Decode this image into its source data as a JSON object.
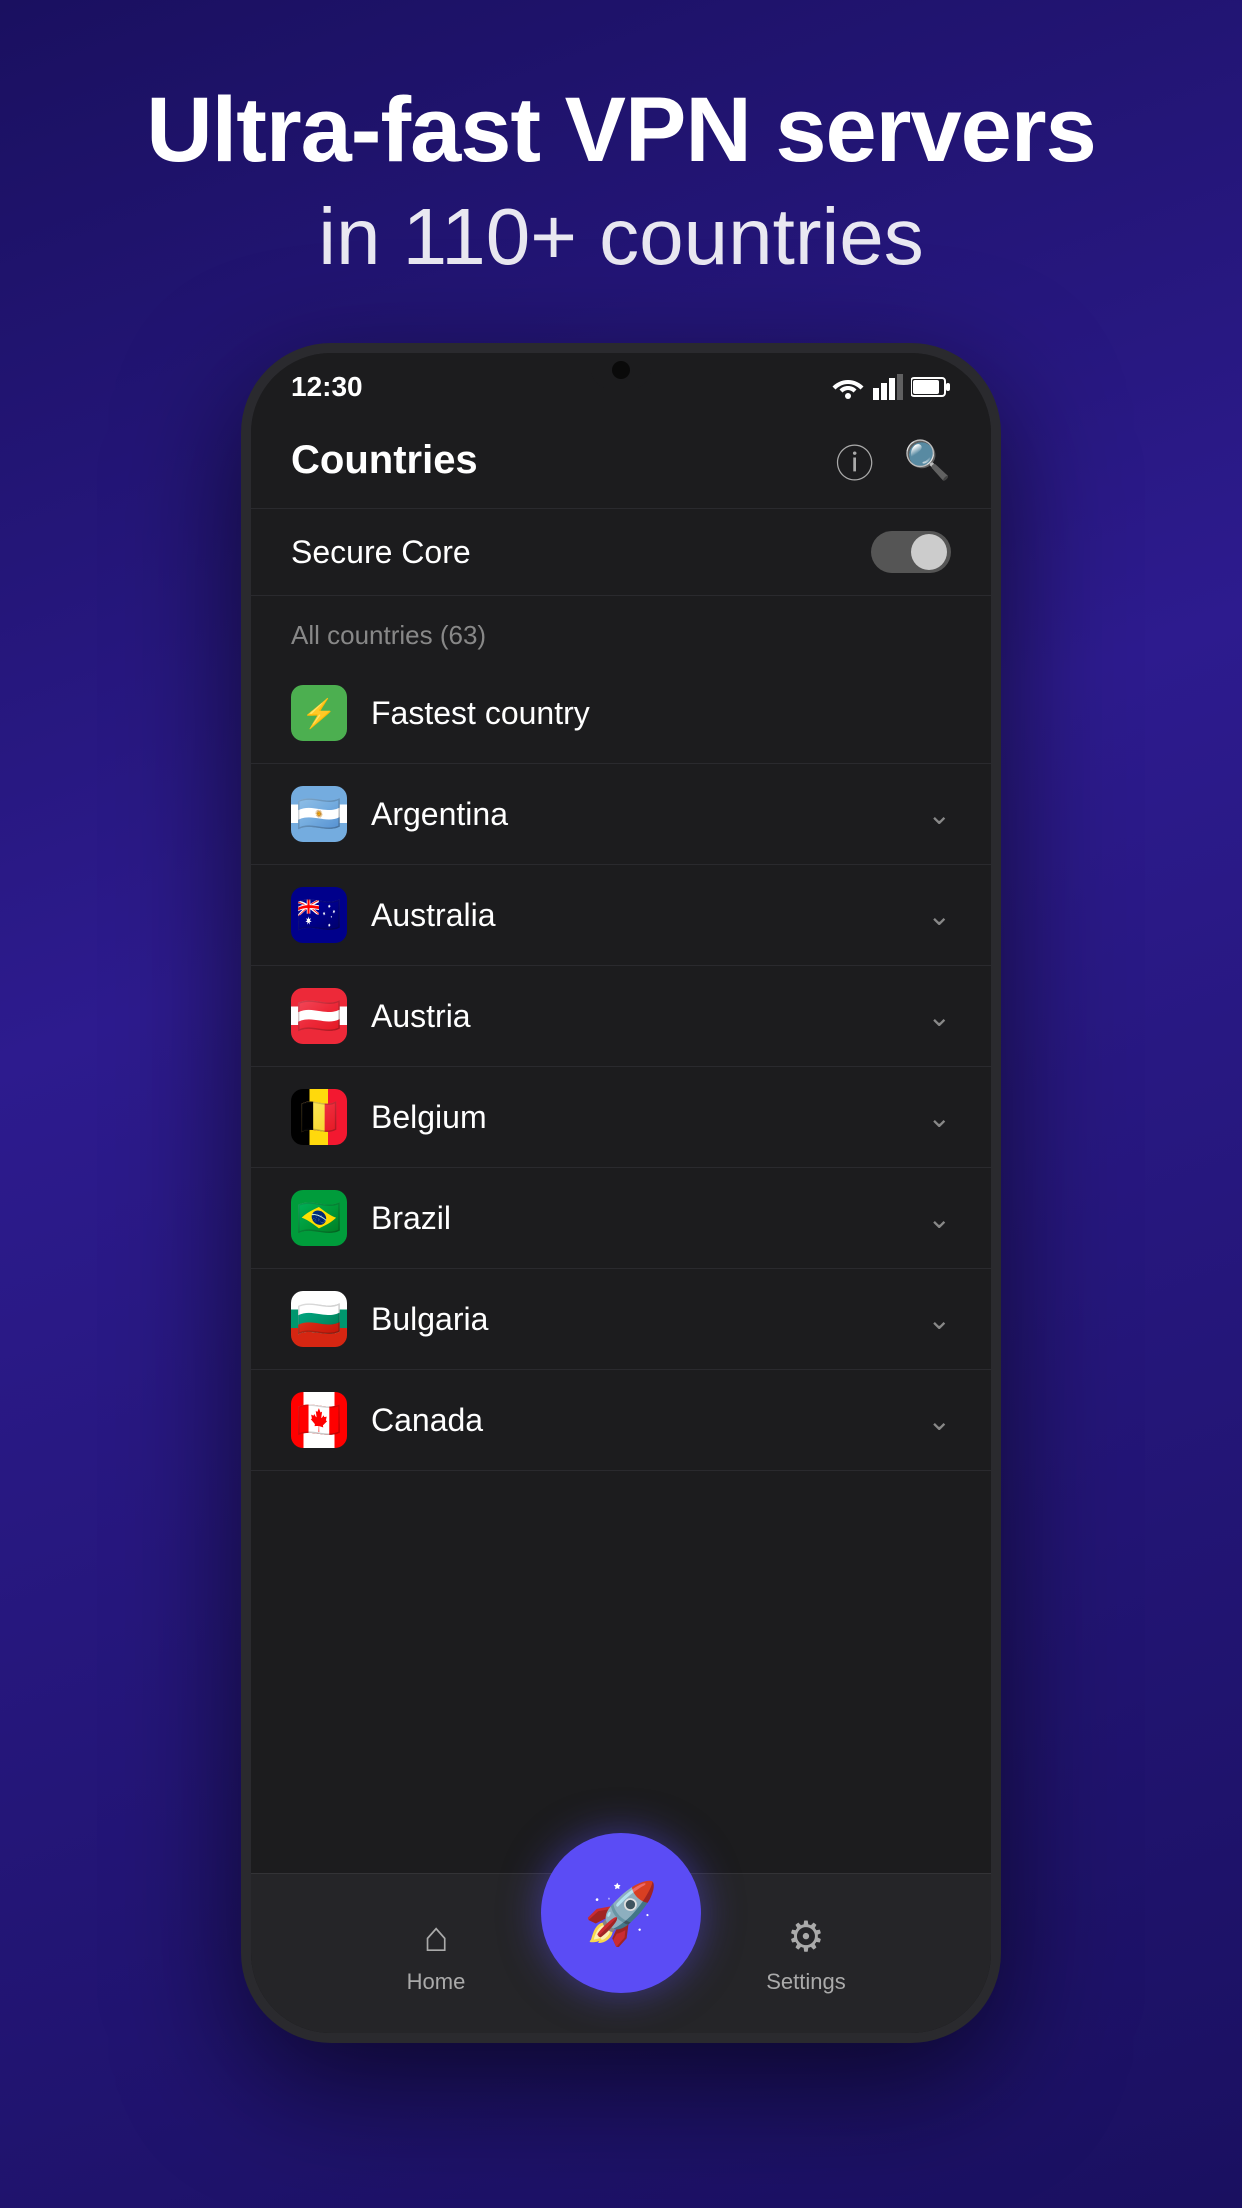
{
  "header": {
    "title_line1": "Ultra-fast VPN servers",
    "title_line2": "in 110+ countries"
  },
  "status_bar": {
    "time": "12:30"
  },
  "app": {
    "title": "Countries",
    "secure_core_label": "Secure Core",
    "section_label": "All countries (63)",
    "fastest_country_label": "Fastest country",
    "countries": [
      {
        "name": "Argentina",
        "flag_emoji": "🇦🇷"
      },
      {
        "name": "Australia",
        "flag_emoji": "🇦🇺"
      },
      {
        "name": "Austria",
        "flag_emoji": "🇦🇹"
      },
      {
        "name": "Belgium",
        "flag_emoji": "🇧🇪"
      },
      {
        "name": "Brazil",
        "flag_emoji": "🇧🇷"
      },
      {
        "name": "Bulgaria",
        "flag_emoji": "🇧🇬"
      },
      {
        "name": "Canada",
        "flag_emoji": "🇨🇦"
      }
    ]
  },
  "bottom_nav": {
    "home_label": "Home",
    "settings_label": "Settings"
  }
}
